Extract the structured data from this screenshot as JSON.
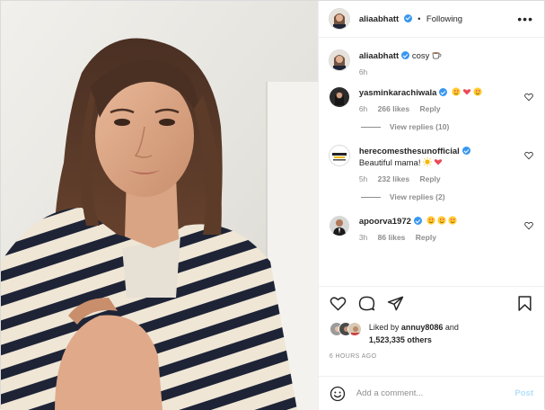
{
  "post": {
    "author": "aliaabhatt",
    "header_status": "Following",
    "menu_icon": "more-horizontal-icon"
  },
  "caption": {
    "author": "aliaabhatt",
    "text": "cosy",
    "emoji": "coffee-cup",
    "time": "6h"
  },
  "comments": [
    {
      "user": "yasminkarachiwala",
      "text": "",
      "emoji": [
        "heart-eyes",
        "red-heart",
        "heart-eyes"
      ],
      "time": "6h",
      "likes": "266 likes",
      "reply": "Reply",
      "view_replies": "View replies (10)"
    },
    {
      "user": "herecomesthesunofficial",
      "text": "Beautiful mama!",
      "emoji": [
        "sun",
        "red-heart"
      ],
      "time": "5h",
      "likes": "232 likes",
      "reply": "Reply",
      "view_replies": "View replies (2)"
    },
    {
      "user": "apoorva1972",
      "text": "",
      "emoji": [
        "heart-eyes",
        "heart-eyes",
        "heart-eyes"
      ],
      "time": "3h",
      "likes": "86 likes",
      "reply": "Reply"
    }
  ],
  "liked_by": {
    "prefix": "Liked by",
    "user": "annuy8086",
    "joiner": "and",
    "others": "1,523,335 others"
  },
  "timestamp": "6 HOURS AGO",
  "add_comment": {
    "placeholder": "Add a comment...",
    "post_label": "Post"
  },
  "colors": {
    "verified": "#3897f0",
    "heart_red": "#ed4956",
    "post_disabled": "#b2dffc",
    "muted": "#8e8e8e"
  }
}
